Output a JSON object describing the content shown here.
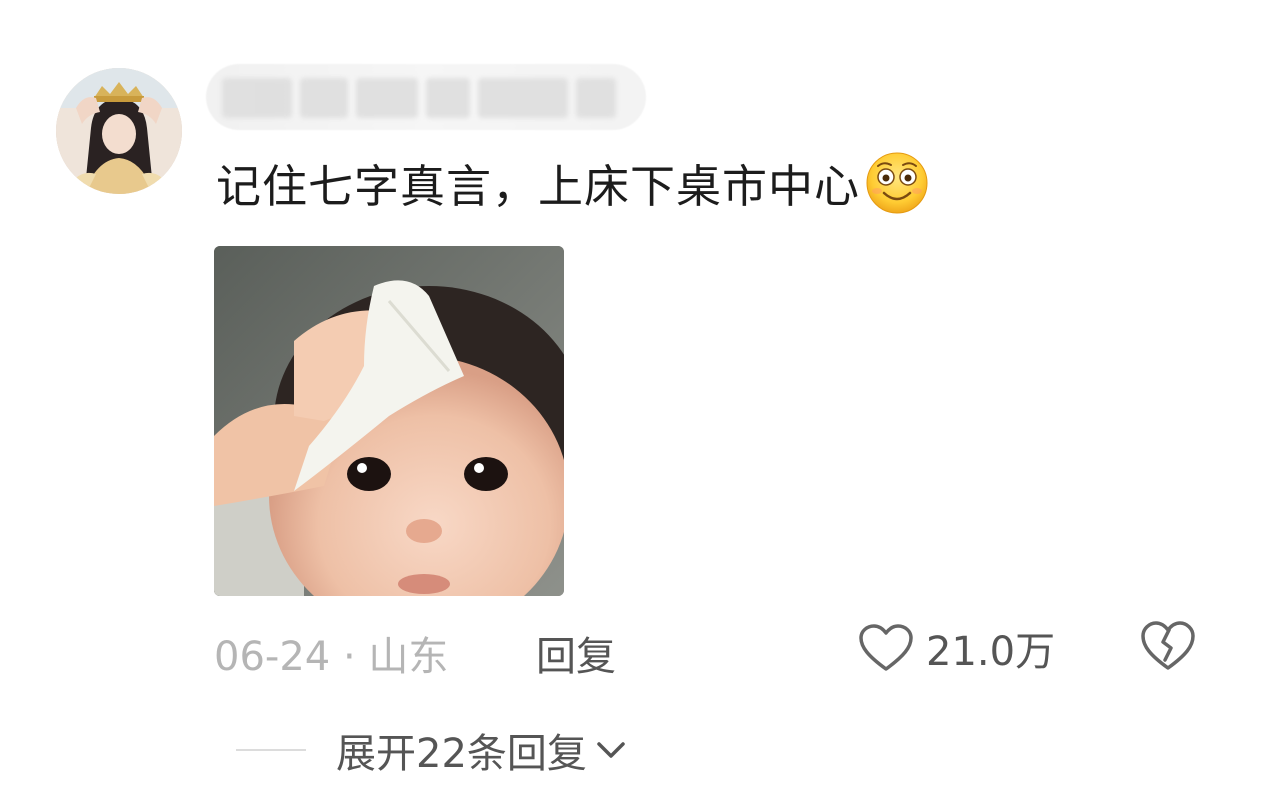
{
  "comment": {
    "avatar_icon": "user-avatar",
    "username_blurred": true,
    "text": "记住七字真言，上床下桌市中心",
    "emoji_icon": "smiling-face-emoji",
    "image_icon": "baby-wiping-forehead-sticker",
    "date_location": "06-24 · 山东",
    "reply_label": "回复",
    "like_icon": "heart-icon",
    "like_count": "21.0万",
    "dislike_icon": "broken-heart-icon"
  },
  "replies": {
    "expand_label": "展开22条回复",
    "chevron_icon": "chevron-down-icon"
  },
  "colors": {
    "text_primary": "#1c1c1c",
    "text_secondary": "#555555",
    "text_muted": "#b5b5b5",
    "divider": "#dcdcdc"
  }
}
